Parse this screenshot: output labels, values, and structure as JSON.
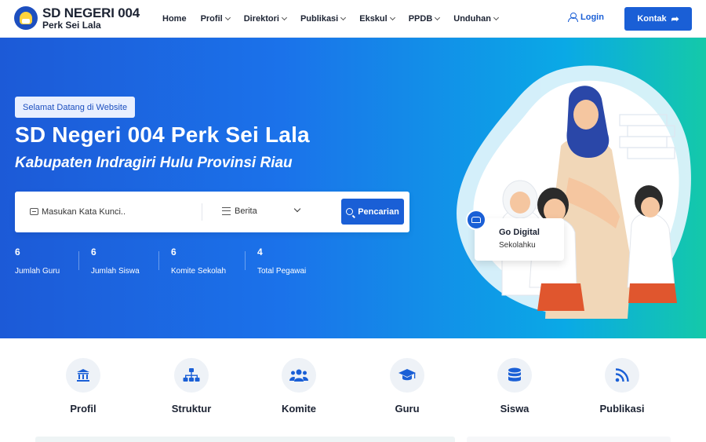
{
  "brand": {
    "title": "SD NEGERI 004",
    "subtitle": "Perk Sei Lala"
  },
  "nav": [
    {
      "label": "Home",
      "dropdown": false
    },
    {
      "label": "Profil",
      "dropdown": true
    },
    {
      "label": "Direktori",
      "dropdown": true
    },
    {
      "label": "Publikasi",
      "dropdown": true
    },
    {
      "label": "Ekskul",
      "dropdown": true
    },
    {
      "label": "PPDB",
      "dropdown": true
    },
    {
      "label": "Unduhan",
      "dropdown": true
    }
  ],
  "header": {
    "login_label": "Login",
    "contact_label": "Kontak"
  },
  "hero": {
    "welcome": "Selamat Datang di Website",
    "title": "SD Negeri 004 Perk Sei Lala",
    "subtitle": "Kabupaten Indragiri Hulu Provinsi Riau"
  },
  "search": {
    "placeholder": "Masukan Kata Kunci..",
    "category": "Berita",
    "button": "Pencarian"
  },
  "stats": [
    {
      "value": "6",
      "label": "Jumlah Guru"
    },
    {
      "value": "6",
      "label": "Jumlah Siswa"
    },
    {
      "value": "6",
      "label": "Komite Sekolah"
    },
    {
      "value": "4",
      "label": "Total Pegawai"
    }
  ],
  "card": {
    "title": "Go Digital",
    "subtitle": "Sekolahku"
  },
  "features": [
    {
      "label": "Profil",
      "icon": "building-icon"
    },
    {
      "label": "Struktur",
      "icon": "hierarchy-icon"
    },
    {
      "label": "Komite",
      "icon": "users-icon"
    },
    {
      "label": "Guru",
      "icon": "graduation-cap-icon"
    },
    {
      "label": "Siswa",
      "icon": "database-icon"
    },
    {
      "label": "Publikasi",
      "icon": "rss-icon"
    }
  ],
  "colors": {
    "primary": "#1a5fd6",
    "gradient_start": "#1c5ad7",
    "gradient_end": "#14c9a9",
    "feature_circle": "#eef2f7"
  }
}
